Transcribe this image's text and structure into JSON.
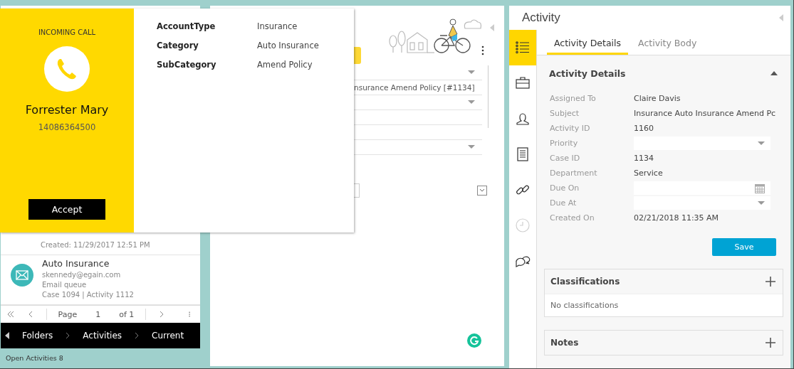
{
  "call_popup": {
    "heading": "INCOMING CALL",
    "caller": "Forrester Mary",
    "number": "14086364500",
    "accept": "Accept",
    "details": [
      {
        "label": "AccountType",
        "value": "Insurance"
      },
      {
        "label": "Category",
        "value": "Auto Insurance"
      },
      {
        "label": "SubCategory",
        "value": "Amend Policy"
      }
    ]
  },
  "activity_list": {
    "items": [
      {
        "kind": "partial",
        "lines": [
          "Created: 11/29/2017 12:51 PM"
        ]
      },
      {
        "kind": "email",
        "title": "Auto Insurance",
        "lines": [
          "skennedy@egain.com",
          "Email queue",
          "Case 1094  |  Activity 1112"
        ]
      }
    ],
    "pager": {
      "label": "Page",
      "page": "1",
      "of": "of 1"
    },
    "breadcrumb": [
      "Folders",
      "Activities",
      "Current"
    ],
    "footer": "Open Activities 8"
  },
  "middle": {
    "fields": [
      {
        "kind": "dropdown"
      },
      {
        "kind": "text",
        "value": "nsurance Amend Policy [#1134]"
      },
      {
        "kind": "dropdown"
      },
      {
        "kind": "text"
      },
      {
        "kind": "text"
      },
      {
        "kind": "dropdown"
      }
    ]
  },
  "activity": {
    "title": "Activity",
    "rail": [
      {
        "selected": true,
        "disabled": false
      },
      {
        "selected": false,
        "disabled": false
      },
      {
        "selected": false,
        "disabled": false
      },
      {
        "selected": false,
        "disabled": false
      },
      {
        "selected": false,
        "disabled": false
      },
      {
        "selected": false,
        "disabled": true
      },
      {
        "selected": false,
        "disabled": false
      }
    ],
    "tabs": [
      {
        "label": "Activity Details",
        "selected": true
      },
      {
        "label": "Activity Body",
        "selected": false
      }
    ],
    "section": {
      "title": "Activity Details",
      "expanded": true,
      "rows": [
        {
          "kind": "text",
          "label": "Assigned To",
          "value": "Claire Davis"
        },
        {
          "kind": "text",
          "label": "Subject",
          "value": "Insurance Auto Insurance Amend Pc"
        },
        {
          "kind": "text",
          "label": "Activity ID",
          "value": "1160"
        },
        {
          "kind": "dropdown",
          "label": "Priority"
        },
        {
          "kind": "text",
          "label": "Case ID",
          "value": "1134"
        },
        {
          "kind": "text",
          "label": "Department",
          "value": "Service"
        },
        {
          "kind": "date",
          "label": "Due On"
        },
        {
          "kind": "dropdown",
          "label": "Due At"
        },
        {
          "kind": "text",
          "label": "Created On",
          "value": "02/21/2018 11:35 AM"
        }
      ]
    },
    "save": "Save",
    "panels": [
      {
        "title": "Classifications",
        "body": "No classifications"
      },
      {
        "title": "Notes"
      }
    ]
  }
}
